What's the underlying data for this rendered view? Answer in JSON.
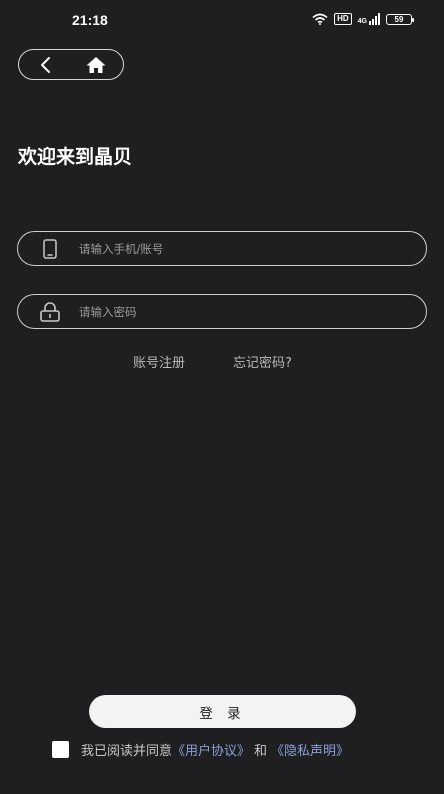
{
  "status_bar": {
    "time": "21:18",
    "hd_label": "HD",
    "signal_label": "4G",
    "battery": "59"
  },
  "nav": {
    "back_icon": "chevron-left-icon",
    "home_icon": "home-icon"
  },
  "welcome_title": "欢迎来到晶贝",
  "phone_input": {
    "placeholder": "请输入手机/账号",
    "value": "",
    "icon": "phone-icon"
  },
  "password_input": {
    "placeholder": "请输入密码",
    "value": "",
    "icon": "lock-icon"
  },
  "links": {
    "register": "账号注册",
    "forgot_password": "忘记密码?"
  },
  "login_button": "登 录",
  "agreement": {
    "checked": false,
    "prefix": "我已阅读并同意",
    "user_agreement": "《用户协议》",
    "and": "和",
    "privacy_policy": "《隐私声明》"
  },
  "colors": {
    "background": "#1f1f22",
    "link_accent": "#8aa0d4",
    "button_bg": "#f3f3f3"
  }
}
